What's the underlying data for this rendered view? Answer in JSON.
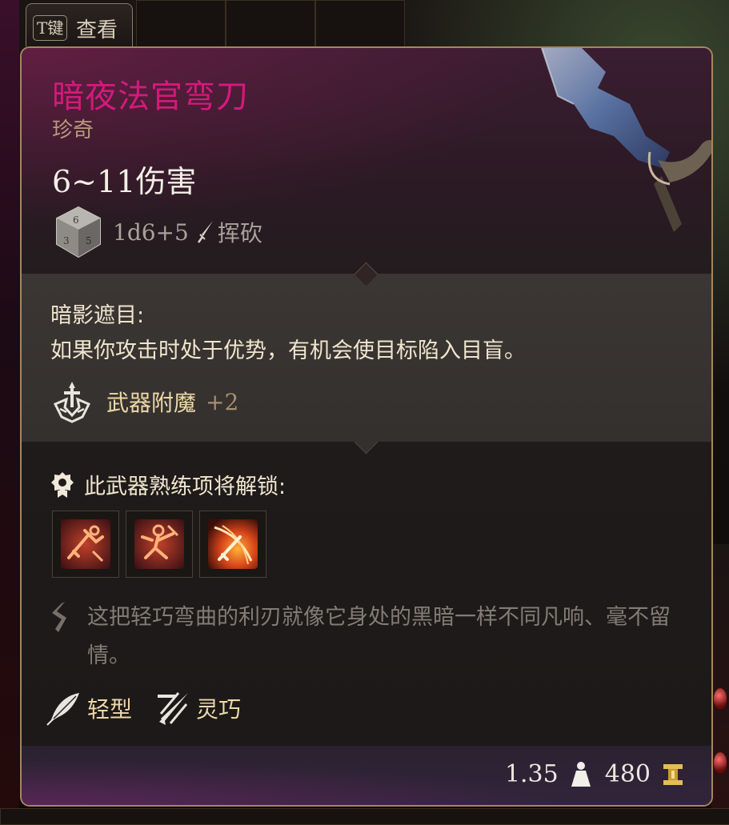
{
  "hint": {
    "key": "T键",
    "action": "查看"
  },
  "item": {
    "name": "暗夜法官弯刀",
    "rarity": "珍奇",
    "damage": "6~11伤害",
    "dice": "1d6+5",
    "damage_type": "挥砍",
    "ability_title": "暗影遮目:",
    "ability_desc": "如果你攻击时处于优势，有机会使目标陷入目盲。",
    "enchant_label": "武器附魔",
    "enchant_value": "+2",
    "proficiency_label": "此武器熟练项将解锁:",
    "lore": "这把轻巧弯曲的利刃就像它身处的黑暗一样不同凡响、毫不留情。",
    "properties": [
      {
        "label": "轻型",
        "icon": "feather-icon"
      },
      {
        "label": "灵巧",
        "icon": "finesse-icon"
      }
    ],
    "weight": "1.35",
    "value": "480"
  },
  "colors": {
    "name": "#d4197b",
    "rarity": "#b79a7c",
    "accent": "#ecd8a8",
    "border": "#a8865c"
  }
}
